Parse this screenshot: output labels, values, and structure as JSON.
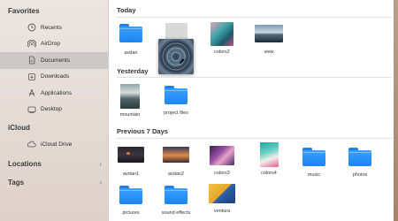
{
  "sidebar": {
    "favorites_header": "Favorites",
    "favorites": [
      {
        "label": "Recents",
        "icon": "clock-icon"
      },
      {
        "label": "AirDrop",
        "icon": "airdrop-icon"
      },
      {
        "label": "Documents",
        "icon": "document-icon",
        "active": true
      },
      {
        "label": "Downloads",
        "icon": "download-icon"
      },
      {
        "label": "Applications",
        "icon": "applications-icon"
      },
      {
        "label": "Desktop",
        "icon": "desktop-icon"
      }
    ],
    "icloud_header": "iCloud",
    "icloud": [
      {
        "label": "iCloud Drive",
        "icon": "cloud-icon"
      }
    ],
    "locations_header": "Locations",
    "tags_header": "Tags"
  },
  "groups": {
    "today": {
      "title": "Today",
      "items": [
        {
          "name": "avdan",
          "type": "folder"
        },
        {
          "name": "",
          "type": "dragging-image"
        },
        {
          "name": "colors2",
          "type": "image"
        },
        {
          "name": "view",
          "type": "image"
        }
      ]
    },
    "yesterday": {
      "title": "Yesterday",
      "items": [
        {
          "name": "mountain",
          "type": "image"
        },
        {
          "name": "project files",
          "type": "folder"
        }
      ]
    },
    "previous7": {
      "title": "Previous 7 Days",
      "items": [
        {
          "name": "avdan1",
          "type": "image"
        },
        {
          "name": "avdan2",
          "type": "image"
        },
        {
          "name": "colors3",
          "type": "image"
        },
        {
          "name": "colors4",
          "type": "image"
        },
        {
          "name": "music",
          "type": "folder"
        },
        {
          "name": "photos",
          "type": "folder"
        },
        {
          "name": "pictures",
          "type": "folder"
        },
        {
          "name": "sound effects",
          "type": "folder"
        },
        {
          "name": "ventura",
          "type": "image"
        }
      ]
    }
  },
  "colors": {
    "folder_blue": "#1d84f0",
    "active_row": "#c8c6c7",
    "sidebar_bg": "#ece7e4"
  }
}
